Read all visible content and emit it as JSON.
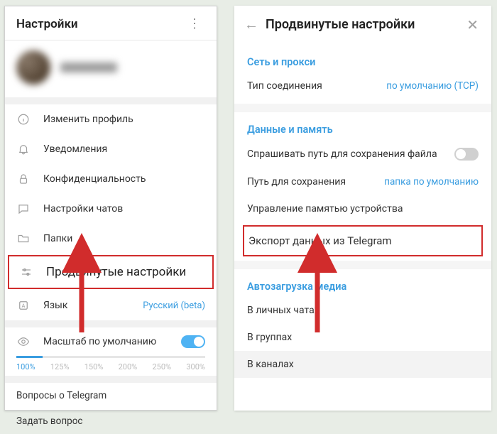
{
  "left": {
    "title": "Настройки",
    "items": {
      "edit_profile": "Изменить профиль",
      "notifications": "Уведомления",
      "privacy": "Конфиденциальность",
      "chat_settings": "Настройки чатов",
      "folders": "Папки",
      "advanced": "Продвинутые настройки",
      "language_label": "Язык",
      "language_value": "Русский (beta)"
    },
    "scale": {
      "label": "Масштаб по умолчанию",
      "ticks": [
        "100%",
        "125%",
        "150%",
        "200%",
        "250%",
        "300%"
      ]
    },
    "help": {
      "about": "Вопросы о Telegram",
      "ask": "Задать вопрос"
    }
  },
  "right": {
    "title": "Продвинутые настройки",
    "net": {
      "header": "Сеть и прокси",
      "conn_label": "Тип соединения",
      "conn_value": "по умолчанию (TCP)"
    },
    "data": {
      "header": "Данные и память",
      "ask_path": "Спрашивать путь для сохранения файла",
      "save_path_label": "Путь для сохранения",
      "save_path_value": "папка по умолчанию",
      "storage": "Управление памятью устройства",
      "export": "Экспорт данных из Telegram"
    },
    "auto": {
      "header": "Автозагрузка медиа",
      "private": "В личных чатах",
      "groups": "В группах",
      "channels": "В каналах"
    }
  }
}
